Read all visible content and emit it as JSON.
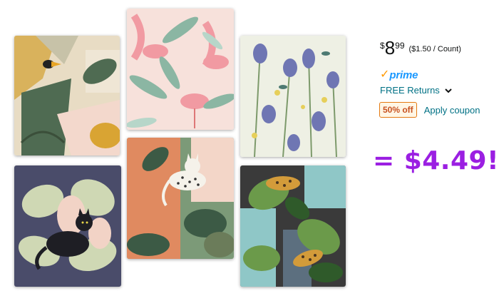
{
  "products": [
    {
      "name": "Toucan tropical"
    },
    {
      "name": "Flamingo leaves"
    },
    {
      "name": "Iris hummingbird"
    },
    {
      "name": "Black cat monstera"
    },
    {
      "name": "Snow leopard"
    },
    {
      "name": "Jungle leopard"
    }
  ],
  "pricing": {
    "symbol": "$",
    "whole": "8",
    "fraction": "99",
    "unit_price": "($1.50 / Count)"
  },
  "shipping": {
    "prime_check": "✓",
    "prime_label": "prime",
    "returns_label": "FREE Returns",
    "icon": "chevron-down-icon"
  },
  "coupon": {
    "badge": "50% off",
    "action": "Apply coupon"
  },
  "annotation": {
    "text": "= $4.49!",
    "color": "#9b1fe2"
  },
  "colors": {
    "link": "#007185",
    "prime": "#1a98ff",
    "prime_check": "#ff9900",
    "coupon_border": "#e47911",
    "coupon_text": "#c7511f"
  }
}
